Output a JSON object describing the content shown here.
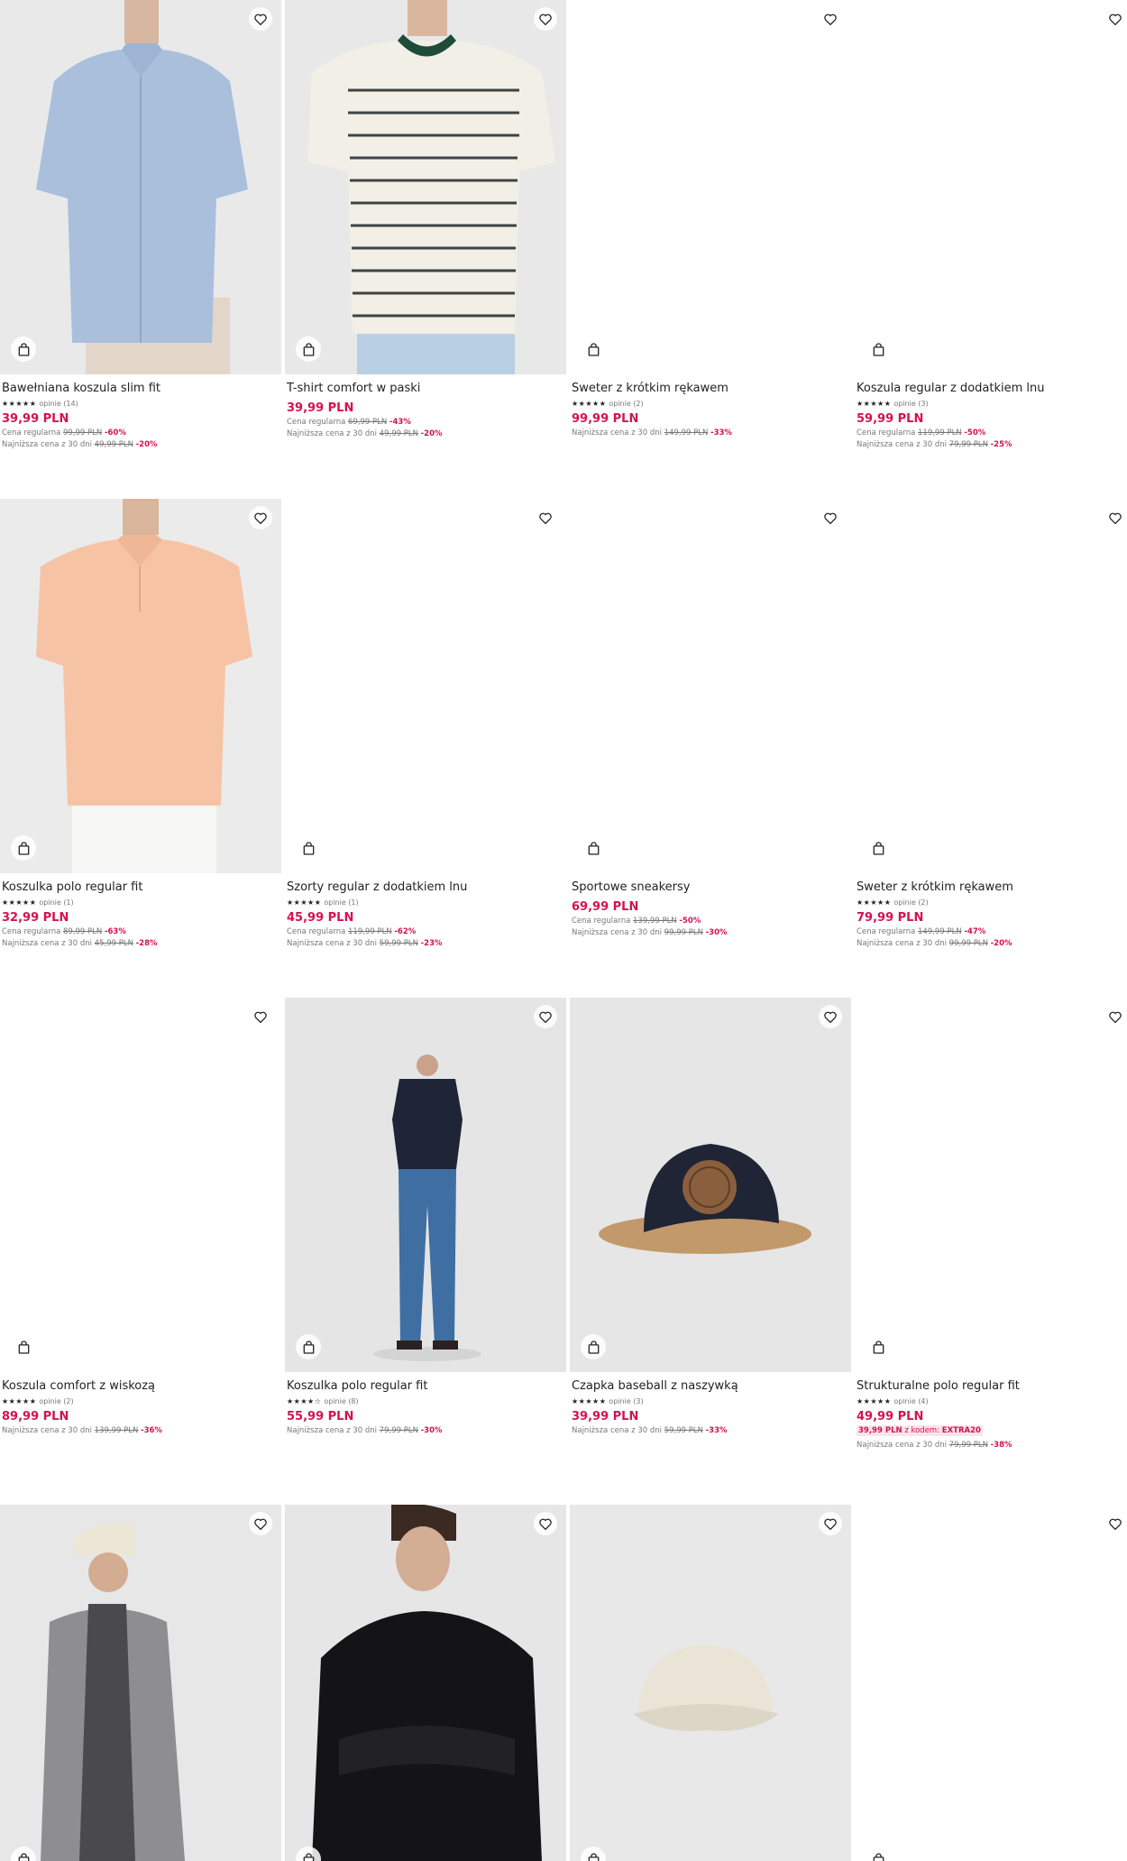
{
  "products": [
    {
      "name": "Bawełniana koszula slim fit",
      "stars": "★★★★★",
      "reviews": "opinie (14)",
      "price": "39,99 PLN",
      "regular_label": "Cena regularna",
      "regular_old": "99,99 PLN",
      "regular_disc": "-60%",
      "lowest_label": "Najniższa cena z 30 dni",
      "lowest_old": "49,99 PLN",
      "lowest_disc": "-20%"
    },
    {
      "name": "T-shirt comfort w paski",
      "stars": "",
      "reviews": "",
      "price": "39,99 PLN",
      "regular_label": "Cena regularna",
      "regular_old": "69,99 PLN",
      "regular_disc": "-43%",
      "lowest_label": "Najniższa cena z 30 dni",
      "lowest_old": "49,99 PLN",
      "lowest_disc": "-20%"
    },
    {
      "name": "Sweter z krótkim rękawem",
      "stars": "★★★★★",
      "reviews": "opinie (2)",
      "price": "99,99 PLN",
      "regular_label": "",
      "regular_old": "",
      "regular_disc": "",
      "lowest_label": "Najniższa cena z 30 dni",
      "lowest_old": "149,99 PLN",
      "lowest_disc": "-33%"
    },
    {
      "name": "Koszula regular z dodatkiem lnu",
      "stars": "★★★★★",
      "reviews": "opinie (3)",
      "price": "59,99 PLN",
      "regular_label": "Cena regularna",
      "regular_old": "119,99 PLN",
      "regular_disc": "-50%",
      "lowest_label": "Najniższa cena z 30 dni",
      "lowest_old": "79,99 PLN",
      "lowest_disc": "-25%"
    },
    {
      "name": "Koszulka polo regular fit",
      "stars": "★★★★★",
      "reviews": "opinie (1)",
      "price": "32,99 PLN",
      "regular_label": "Cena regularna",
      "regular_old": "89,99 PLN",
      "regular_disc": "-63%",
      "lowest_label": "Najniższa cena z 30 dni",
      "lowest_old": "45,99 PLN",
      "lowest_disc": "-28%"
    },
    {
      "name": "Szorty regular z dodatkiem lnu",
      "stars": "★★★★★",
      "reviews": "opinie (1)",
      "price": "45,99 PLN",
      "regular_label": "Cena regularna",
      "regular_old": "119,99 PLN",
      "regular_disc": "-62%",
      "lowest_label": "Najniższa cena z 30 dni",
      "lowest_old": "59,99 PLN",
      "lowest_disc": "-23%"
    },
    {
      "name": "Sportowe sneakersy",
      "stars": "",
      "reviews": "",
      "price": "69,99 PLN",
      "regular_label": "Cena regularna",
      "regular_old": "139,99 PLN",
      "regular_disc": "-50%",
      "lowest_label": "Najniższa cena z 30 dni",
      "lowest_old": "99,99 PLN",
      "lowest_disc": "-30%"
    },
    {
      "name": "Sweter z krótkim rękawem",
      "stars": "★★★★★",
      "reviews": "opinie (2)",
      "price": "79,99 PLN",
      "regular_label": "Cena regularna",
      "regular_old": "149,99 PLN",
      "regular_disc": "-47%",
      "lowest_label": "Najniższa cena z 30 dni",
      "lowest_old": "99,99 PLN",
      "lowest_disc": "-20%"
    },
    {
      "name": "Koszula comfort z wiskozą",
      "stars": "★★★★★",
      "reviews": "opinie (2)",
      "price": "89,99 PLN",
      "regular_label": "",
      "regular_old": "",
      "regular_disc": "",
      "lowest_label": "Najniższa cena z 30 dni",
      "lowest_old": "139,99 PLN",
      "lowest_disc": "-36%"
    },
    {
      "name": "Koszulka polo regular fit",
      "stars": "★★★★☆",
      "reviews": "opinie (8)",
      "price": "55,99 PLN",
      "regular_label": "",
      "regular_old": "",
      "regular_disc": "",
      "lowest_label": "Najniższa cena z 30 dni",
      "lowest_old": "79,99 PLN",
      "lowest_disc": "-30%"
    },
    {
      "name": "Czapka baseball z naszywką",
      "stars": "★★★★★",
      "reviews": "opinie (3)",
      "price": "39,99 PLN",
      "regular_label": "",
      "regular_old": "",
      "regular_disc": "",
      "lowest_label": "Najniższa cena z 30 dni",
      "lowest_old": "59,99 PLN",
      "lowest_disc": "-33%"
    },
    {
      "name": "Strukturalne polo regular fit",
      "stars": "★★★★★",
      "reviews": "opinie (4)",
      "price": "49,99 PLN",
      "promo_price": "39,99 PLN",
      "promo_text": "z kodem:",
      "promo_code": "EXTRA20",
      "regular_label": "",
      "regular_old": "",
      "regular_disc": "",
      "lowest_label": "Najniższa cena z 30 dni",
      "lowest_old": "79,99 PLN",
      "lowest_disc": "-38%"
    },
    {
      "name": "",
      "stars": "",
      "reviews": "",
      "price": ""
    },
    {
      "name": "",
      "stars": "",
      "reviews": "",
      "price": ""
    },
    {
      "name": "",
      "stars": "",
      "reviews": "",
      "price": ""
    },
    {
      "name": "",
      "stars": "",
      "reviews": "",
      "price": ""
    }
  ]
}
